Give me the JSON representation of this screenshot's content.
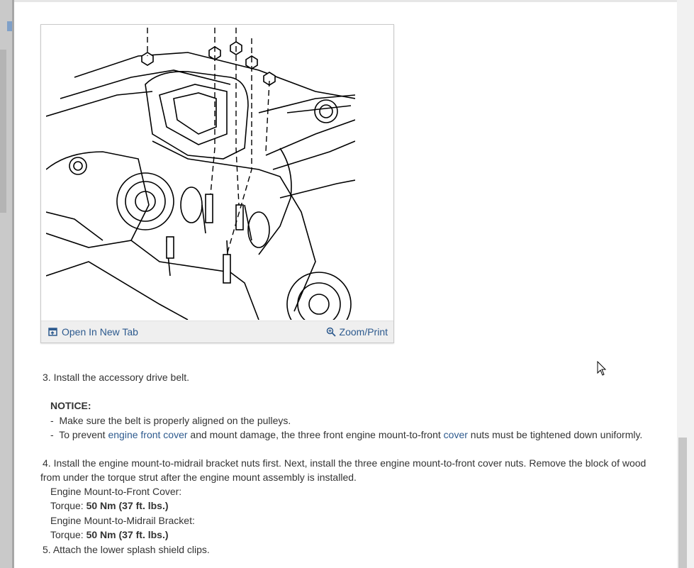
{
  "figure": {
    "open_new_tab_label": "Open In New Tab",
    "zoom_print_label": "Zoom/Print",
    "open_icon": "open-in-new-tab-icon",
    "zoom_icon": "magnifier-icon"
  },
  "steps": {
    "step3": {
      "number": "3.",
      "text": "Install the accessory drive belt."
    },
    "notice": {
      "heading": "NOTICE:",
      "item1": "Make sure the belt is properly aligned on the pulleys.",
      "item2_before": "To prevent ",
      "item2_link1": "engine front cover",
      "item2_middle": " and mount damage, the three front engine mount-to-front ",
      "item2_link2": "cover",
      "item2_after": " nuts must be tightened down uniformly.",
      "bullet": "-"
    },
    "step4": {
      "number": "4.",
      "text_line1": "Install the engine mount-to-midrail bracket nuts first. Next, install the three engine mount-to-front cover nuts. Remove the block of wood",
      "text_line2": "from under the torque strut after the engine mount assembly is installed.",
      "spec1_label": "Engine Mount-to-Front Cover:",
      "spec1_torque_label": "Torque: ",
      "spec1_torque_value": "50 Nm (37 ft. lbs.)",
      "spec2_label": "Engine Mount-to-Midrail Bracket:",
      "spec2_torque_label": "Torque: ",
      "spec2_torque_value": "50 Nm (37 ft. lbs.)"
    },
    "step5": {
      "number": "5.",
      "text": "Attach the lower splash shield clips."
    }
  },
  "colors": {
    "link": "#2d5a8e",
    "text": "#333333",
    "toolbar_bg": "#efefef"
  }
}
